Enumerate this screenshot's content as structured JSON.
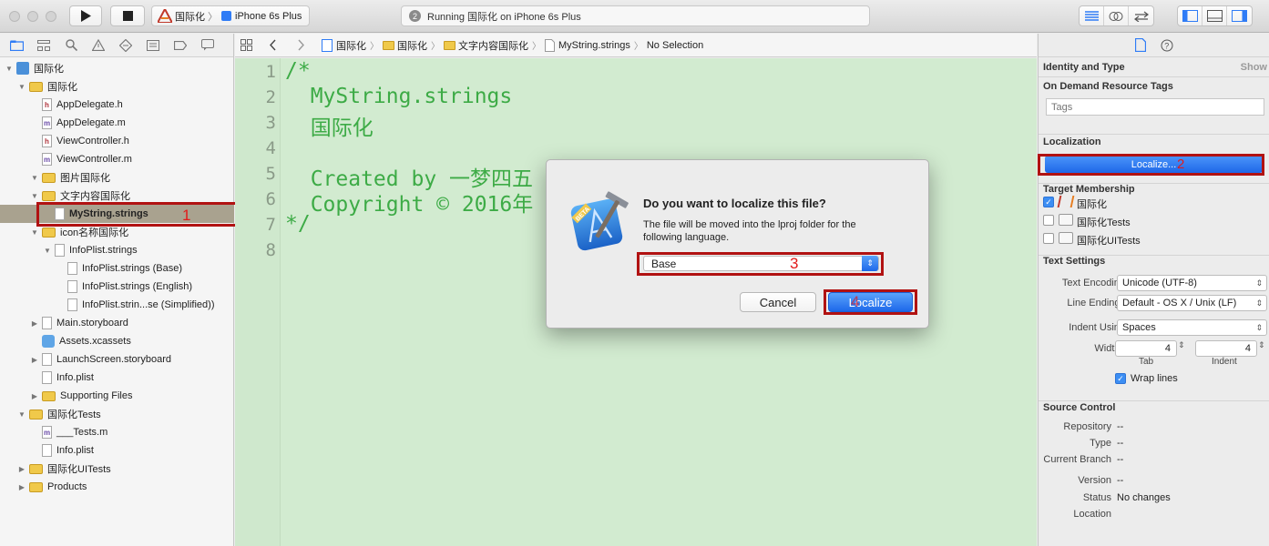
{
  "toolbar": {
    "scheme_target": "国际化",
    "scheme_device": "iPhone 6s Plus",
    "activity_badge": "2",
    "activity_text": "Running 国际化 on iPhone 6s Plus"
  },
  "navigator": {
    "items": [
      {
        "label": "国际化",
        "indent": 0,
        "kind": "project",
        "disclosure": "open"
      },
      {
        "label": "国际化",
        "indent": 1,
        "kind": "folder",
        "disclosure": "open"
      },
      {
        "label": "AppDelegate.h",
        "indent": 2,
        "kind": "h"
      },
      {
        "label": "AppDelegate.m",
        "indent": 2,
        "kind": "m"
      },
      {
        "label": "ViewController.h",
        "indent": 2,
        "kind": "h"
      },
      {
        "label": "ViewController.m",
        "indent": 2,
        "kind": "m"
      },
      {
        "label": "图片国际化",
        "indent": 2,
        "kind": "folder",
        "disclosure": "open"
      },
      {
        "label": "文字内容国际化",
        "indent": 2,
        "kind": "folder",
        "disclosure": "open"
      },
      {
        "label": "MyString.strings",
        "indent": 3,
        "kind": "file",
        "selected": true
      },
      {
        "label": "icon名称国际化",
        "indent": 2,
        "kind": "folder",
        "disclosure": "open"
      },
      {
        "label": "InfoPlist.strings",
        "indent": 3,
        "kind": "file",
        "disclosure": "open"
      },
      {
        "label": "InfoPlist.strings (Base)",
        "indent": 4,
        "kind": "file"
      },
      {
        "label": "InfoPlist.strings (English)",
        "indent": 4,
        "kind": "file"
      },
      {
        "label": "InfoPlist.strin...se (Simplified))",
        "indent": 4,
        "kind": "file"
      },
      {
        "label": "Main.storyboard",
        "indent": 2,
        "kind": "file",
        "disclosure": "closed"
      },
      {
        "label": "Assets.xcassets",
        "indent": 2,
        "kind": "assets"
      },
      {
        "label": "LaunchScreen.storyboard",
        "indent": 2,
        "kind": "file",
        "disclosure": "closed"
      },
      {
        "label": "Info.plist",
        "indent": 2,
        "kind": "file"
      },
      {
        "label": "Supporting Files",
        "indent": 2,
        "kind": "folder",
        "disclosure": "closed"
      },
      {
        "label": "国际化Tests",
        "indent": 1,
        "kind": "folder",
        "disclosure": "open"
      },
      {
        "label": "___Tests.m",
        "indent": 2,
        "kind": "m"
      },
      {
        "label": "Info.plist",
        "indent": 2,
        "kind": "file"
      },
      {
        "label": "国际化UITests",
        "indent": 1,
        "kind": "folder",
        "disclosure": "closed"
      },
      {
        "label": "Products",
        "indent": 1,
        "kind": "folder",
        "disclosure": "closed"
      }
    ],
    "annotation_1": "1"
  },
  "jumpbar": {
    "crumbs": [
      "国际化",
      "国际化",
      "文字内容国际化",
      "MyString.strings",
      "No Selection"
    ]
  },
  "editor": {
    "line_numbers": [
      "1",
      "2",
      "3",
      "4",
      "5",
      "6",
      "7",
      "8"
    ],
    "lines": [
      "/*",
      "  MyString.strings",
      "  国际化",
      "",
      "  Created by 一梦四五",
      "  Copyright © 2016年",
      "*/",
      ""
    ]
  },
  "modal": {
    "title": "Do you want to localize this file?",
    "message": "The file will be moved into the lproj folder for the following language.",
    "language_value": "Base",
    "cancel_label": "Cancel",
    "localize_label": "Localize",
    "annotation_3": "3",
    "annotation_4": "4"
  },
  "inspector": {
    "identity_type": "Identity and Type",
    "show_label": "Show",
    "on_demand_tags": "On Demand Resource Tags",
    "tags_placeholder": "Tags",
    "localization_title": "Localization",
    "localize_button": "Localize...",
    "annotation_2": "2",
    "target_membership": "Target Membership",
    "targets": [
      {
        "label": "国际化",
        "checked": true
      },
      {
        "label": "国际化Tests",
        "checked": false
      },
      {
        "label": "国际化UITests",
        "checked": false
      }
    ],
    "text_settings": "Text Settings",
    "text_encoding_label": "Text Encoding",
    "text_encoding_value": "Unicode (UTF-8)",
    "line_endings_label": "Line Endings",
    "line_endings_value": "Default - OS X / Unix (LF)",
    "indent_using_label": "Indent Using",
    "indent_using_value": "Spaces",
    "widths_label": "Widths",
    "tab_value": "4",
    "indent_value": "4",
    "tab_label": "Tab",
    "indent_label": "Indent",
    "wrap_lines": "Wrap lines",
    "source_control": "Source Control",
    "repository_label": "Repository",
    "repository_value": "--",
    "type_label": "Type",
    "type_value": "--",
    "branch_label": "Current Branch",
    "branch_value": "--",
    "version_label": "Version",
    "version_value": "--",
    "status_label": "Status",
    "status_value": "No changes",
    "location_label": "Location"
  },
  "colors": {
    "editor_bg": "#d2ebd0",
    "code_text": "#3dab46",
    "annotation_red": "#e21b1b",
    "selection": "#a9a28f",
    "accent_blue": "#2f7cf6"
  }
}
